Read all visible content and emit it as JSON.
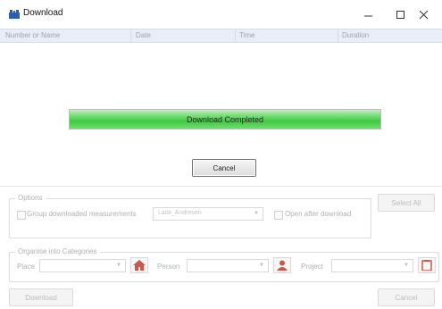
{
  "window": {
    "title": "Download"
  },
  "columns": [
    "Number or Name",
    "Date",
    "Time",
    "Duration"
  ],
  "progress": {
    "label": "Download Completed",
    "value": 1.0
  },
  "cancel_mid_label": "Cancel",
  "options": {
    "title": "Options",
    "group_label": "Group downloaded measurements",
    "person_value": "Laila_Andresen",
    "open_after_label": "Open after download",
    "select_all_label": "Select All"
  },
  "organise": {
    "title": "Organise into Categories",
    "place_label": "Place",
    "person_label": "Person",
    "project_label": "Project"
  },
  "footer": {
    "download_label": "Download",
    "cancel_label": "Cancel"
  }
}
